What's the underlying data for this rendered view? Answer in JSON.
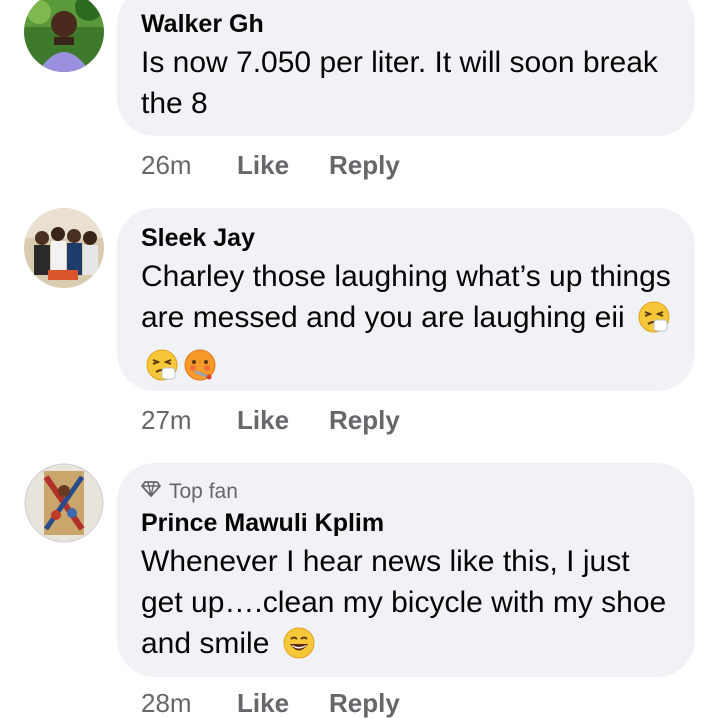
{
  "comments": [
    {
      "author": "Walker Gh",
      "text": "Is now 7.050 per liter. It will soon break the 8",
      "time": "26m",
      "like_label": "Like",
      "reply_label": "Reply"
    },
    {
      "author": "Sleek Jay",
      "text": "Charley those laughing what’s up things are messed and you are laughing eii",
      "emojis": [
        "sneezing-face",
        "sneezing-face",
        "face-with-thermometer"
      ],
      "time": "27m",
      "like_label": "Like",
      "reply_label": "Reply"
    },
    {
      "badge": "Top fan",
      "badge_icon": "diamond-icon",
      "author": "Prince Mawuli Kplim",
      "text": "Whenever I hear news like this, I just get up….clean my bicycle with my shoe and smile",
      "emojis": [
        "grinning-face-with-smiling-eyes"
      ],
      "time": "28m",
      "like_label": "Like",
      "reply_label": "Reply"
    }
  ],
  "colors": {
    "bubble": "#f0f2f5",
    "meta": "#65676b",
    "text": "#050505"
  }
}
